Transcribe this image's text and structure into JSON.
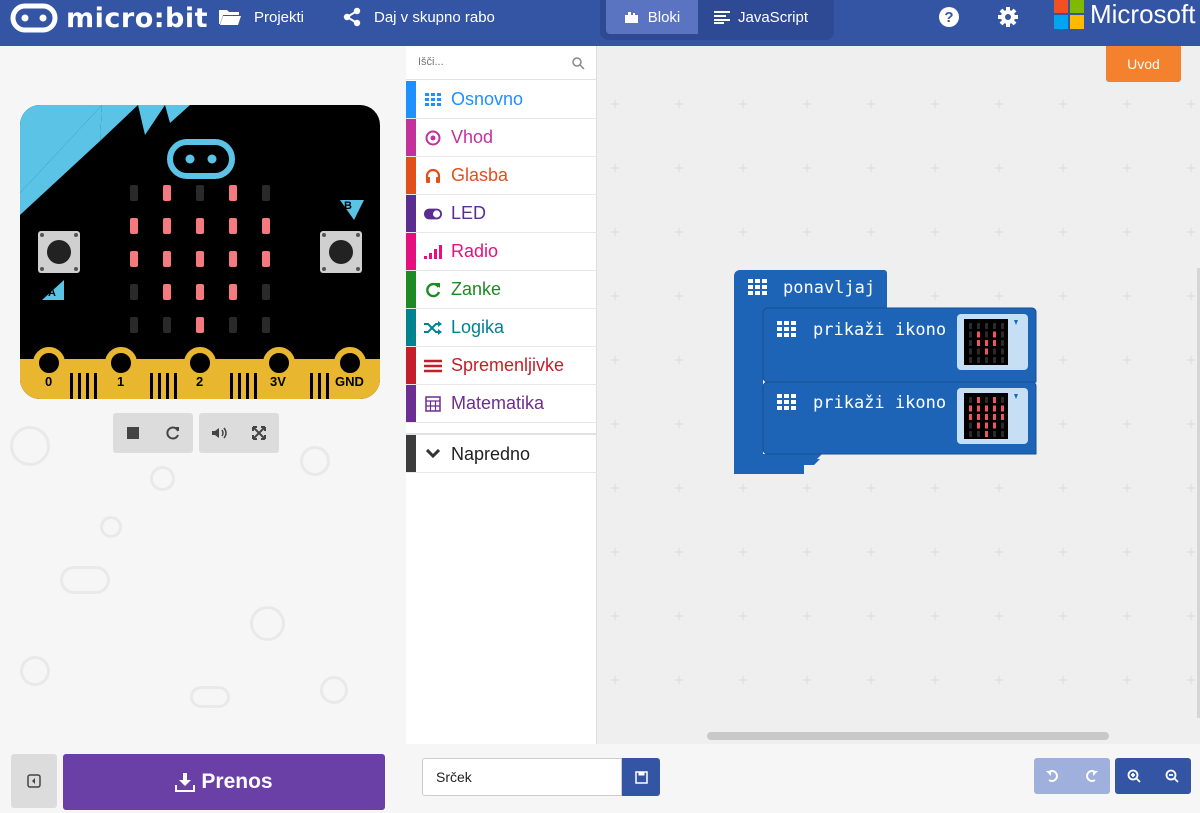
{
  "header": {
    "brand": "micro:bit",
    "projects_label": "Projekti",
    "share_label": "Daj v skupno rabo",
    "editor_tabs": [
      {
        "label": "Bloki",
        "active": true
      },
      {
        "label": "JavaScript",
        "active": false
      }
    ],
    "help_icon": "help-icon",
    "settings_icon": "gear-icon",
    "partner_logo": "Microsoft"
  },
  "simulator": {
    "pins": [
      "0",
      "1",
      "2",
      "3V",
      "GND"
    ],
    "button_a": "A",
    "button_b": "B",
    "led_matrix": [
      [
        0,
        1,
        0,
        1,
        0
      ],
      [
        1,
        1,
        1,
        1,
        1
      ],
      [
        1,
        1,
        1,
        1,
        1
      ],
      [
        0,
        1,
        1,
        1,
        0
      ],
      [
        0,
        0,
        1,
        0,
        0
      ]
    ],
    "led_on_color": "#f57a80",
    "controls": [
      "stop-icon",
      "restart-icon",
      "sound-icon",
      "fullscreen-icon"
    ]
  },
  "toolbox": {
    "search_placeholder": "Išči...",
    "categories": [
      {
        "label": "Osnovno",
        "color": "#1e90ff",
        "bar": "#1e90ff",
        "icon": "grid-icon"
      },
      {
        "label": "Vhod",
        "color": "#c3319a",
        "bar": "#c3319a",
        "icon": "target-icon"
      },
      {
        "label": "Glasba",
        "color": "#e1501a",
        "bar": "#e1501a",
        "icon": "headphones-icon"
      },
      {
        "label": "LED",
        "color": "#5c2d91",
        "bar": "#5c2d91",
        "icon": "toggle-icon"
      },
      {
        "label": "Radio",
        "color": "#e3107d",
        "bar": "#e3107d",
        "icon": "signal-icon"
      },
      {
        "label": "Zanke",
        "color": "#1d8a24",
        "bar": "#1d8a24",
        "icon": "loop-icon"
      },
      {
        "label": "Logika",
        "color": "#00838f",
        "bar": "#00838f",
        "icon": "shuffle-icon"
      },
      {
        "label": "Spremenljivke",
        "color": "#c21f2a",
        "bar": "#c21f2a",
        "icon": "lines-icon"
      },
      {
        "label": "Matematika",
        "color": "#6c2e91",
        "bar": "#6c2e91",
        "icon": "calculator-icon"
      }
    ],
    "advanced_label": "Napredno"
  },
  "workspace": {
    "intro_label": "Uvod",
    "block_color": "#1e64b6",
    "block_color_dark": "#174f91",
    "forever_label": "ponavljaj",
    "show_icon_blocks": [
      {
        "label": "prikaži ikono",
        "icon": "heart-icon"
      },
      {
        "label": "prikaži ikono",
        "icon": "small-heart-icon"
      }
    ]
  },
  "footer": {
    "download_label": "Prenos",
    "project_name": "Srček",
    "undo_icon": "undo-icon",
    "redo_icon": "redo-icon",
    "zoom_in_icon": "zoom-in-icon",
    "zoom_out_icon": "zoom-out-icon"
  }
}
